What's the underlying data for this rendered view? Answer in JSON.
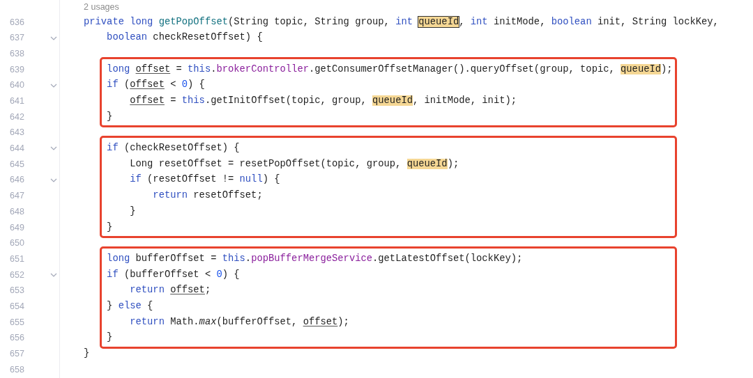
{
  "usage_hint": "2 usages",
  "blocks": [
    {
      "kind": "plain",
      "lines": [
        {
          "number": "636",
          "foldable": false,
          "tokens": [
            {
              "kind": "keyword",
              "text": "private"
            },
            {
              "kind": "keyword",
              "text": " long"
            },
            {
              "kind": "declaration",
              "text": " getPopOffset"
            },
            {
              "kind": "plain",
              "text": "(String topic, String group, "
            },
            {
              "kind": "keyword",
              "text": "int"
            },
            {
              "kind": "match-current",
              "text": " queueId"
            },
            {
              "kind": "plain",
              "text": ", "
            },
            {
              "kind": "keyword",
              "text": "int"
            },
            {
              "kind": "plain",
              "text": " initMode, "
            },
            {
              "kind": "keyword",
              "text": "boolean"
            },
            {
              "kind": "plain",
              "text": " init, String lockKey,"
            }
          ]
        },
        {
          "number": "637",
          "foldable": true,
          "tokens": [
            {
              "kind": "keyword",
              "text": "    boolean"
            },
            {
              "kind": "plain",
              "text": " checkResetOffset) {"
            }
          ]
        },
        {
          "number": "638",
          "foldable": false
        }
      ]
    },
    {
      "kind": "annotated",
      "lines": [
        {
          "number": "639",
          "foldable": false,
          "tokens": [
            {
              "kind": "keyword",
              "text": "    long"
            },
            {
              "kind": "reassigned",
              "text": " offset"
            },
            {
              "kind": "plain",
              "text": " = "
            },
            {
              "kind": "keyword",
              "text": "this"
            },
            {
              "kind": "plain",
              "text": "."
            },
            {
              "kind": "field",
              "text": "brokerController"
            },
            {
              "kind": "plain",
              "text": ".getConsumerOffsetManager().queryOffset(group, topic, "
            },
            {
              "kind": "match",
              "text": "queueId"
            },
            {
              "kind": "plain",
              "text": ");"
            }
          ]
        },
        {
          "number": "640",
          "foldable": true,
          "tokens": [
            {
              "kind": "keyword",
              "text": "    if"
            },
            {
              "kind": "plain",
              "text": " ("
            },
            {
              "kind": "reassigned",
              "text": "offset"
            },
            {
              "kind": "plain",
              "text": " < "
            },
            {
              "kind": "number",
              "text": "0"
            },
            {
              "kind": "plain",
              "text": ") {"
            }
          ]
        },
        {
          "number": "641",
          "foldable": false,
          "tokens": [
            {
              "kind": "reassigned",
              "text": "        offset"
            },
            {
              "kind": "plain",
              "text": " = "
            },
            {
              "kind": "keyword",
              "text": "this"
            },
            {
              "kind": "plain",
              "text": ".getInitOffset(topic, group, "
            },
            {
              "kind": "match",
              "text": "queueId"
            },
            {
              "kind": "plain",
              "text": ", initMode, init);"
            }
          ]
        },
        {
          "number": "642",
          "foldable": false,
          "tokens": [
            {
              "kind": "plain",
              "text": "    }"
            }
          ]
        }
      ]
    },
    {
      "kind": "plain",
      "lines": [
        {
          "number": "643",
          "foldable": false
        }
      ]
    },
    {
      "kind": "annotated",
      "lines": [
        {
          "number": "644",
          "foldable": true,
          "tokens": [
            {
              "kind": "keyword",
              "text": "    if"
            },
            {
              "kind": "plain",
              "text": " (checkResetOffset) {"
            }
          ]
        },
        {
          "number": "645",
          "foldable": false,
          "tokens": [
            {
              "kind": "plain",
              "text": "        Long resetOffset = resetPopOffset(topic, group, "
            },
            {
              "kind": "match",
              "text": "queueId"
            },
            {
              "kind": "plain",
              "text": ");"
            }
          ]
        },
        {
          "number": "646",
          "foldable": true,
          "tokens": [
            {
              "kind": "keyword",
              "text": "        if"
            },
            {
              "kind": "plain",
              "text": " (resetOffset != "
            },
            {
              "kind": "keyword",
              "text": "null"
            },
            {
              "kind": "plain",
              "text": ") {"
            }
          ]
        },
        {
          "number": "647",
          "foldable": false,
          "tokens": [
            {
              "kind": "keyword",
              "text": "            return"
            },
            {
              "kind": "plain",
              "text": " resetOffset;"
            }
          ]
        },
        {
          "number": "648",
          "foldable": false,
          "tokens": [
            {
              "kind": "plain",
              "text": "        }"
            }
          ]
        },
        {
          "number": "649",
          "foldable": false,
          "tokens": [
            {
              "kind": "plain",
              "text": "    }"
            }
          ]
        }
      ]
    },
    {
      "kind": "plain",
      "lines": [
        {
          "number": "650",
          "foldable": false
        }
      ]
    },
    {
      "kind": "annotated",
      "lines": [
        {
          "number": "651",
          "foldable": false,
          "tokens": [
            {
              "kind": "keyword",
              "text": "    long"
            },
            {
              "kind": "plain",
              "text": " bufferOffset = "
            },
            {
              "kind": "keyword",
              "text": "this"
            },
            {
              "kind": "plain",
              "text": "."
            },
            {
              "kind": "field",
              "text": "popBufferMergeService"
            },
            {
              "kind": "plain",
              "text": ".getLatestOffset(lockKey);"
            }
          ]
        },
        {
          "number": "652",
          "foldable": true,
          "tokens": [
            {
              "kind": "keyword",
              "text": "    if"
            },
            {
              "kind": "plain",
              "text": " (bufferOffset < "
            },
            {
              "kind": "number",
              "text": "0"
            },
            {
              "kind": "plain",
              "text": ") {"
            }
          ]
        },
        {
          "number": "653",
          "foldable": false,
          "tokens": [
            {
              "kind": "keyword",
              "text": "        return"
            },
            {
              "kind": "reassigned",
              "text": " offset"
            },
            {
              "kind": "plain",
              "text": ";"
            }
          ]
        },
        {
          "number": "654",
          "foldable": false,
          "tokens": [
            {
              "kind": "plain",
              "text": "    } "
            },
            {
              "kind": "keyword",
              "text": "else"
            },
            {
              "kind": "plain",
              "text": " {"
            }
          ]
        },
        {
          "number": "655",
          "foldable": false,
          "tokens": [
            {
              "kind": "keyword",
              "text": "        return"
            },
            {
              "kind": "plain",
              "text": " Math."
            },
            {
              "kind": "static-call",
              "text": "max"
            },
            {
              "kind": "plain",
              "text": "(bufferOffset, "
            },
            {
              "kind": "reassigned",
              "text": "offset"
            },
            {
              "kind": "plain",
              "text": ");"
            }
          ]
        },
        {
          "number": "656",
          "foldable": false,
          "tokens": [
            {
              "kind": "plain",
              "text": "    }"
            }
          ]
        }
      ]
    },
    {
      "kind": "plain",
      "lines": [
        {
          "number": "657",
          "foldable": false,
          "tokens": [
            {
              "kind": "plain",
              "text": "}"
            }
          ]
        },
        {
          "number": "658",
          "foldable": false
        }
      ]
    }
  ]
}
